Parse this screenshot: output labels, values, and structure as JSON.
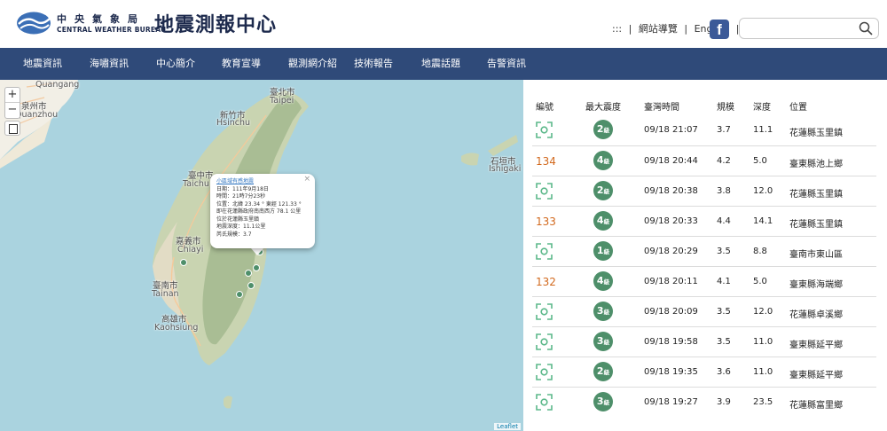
{
  "header": {
    "org_name_zh": "中央氣象局",
    "org_name_en": "CENTRAL WEATHER BUREAU",
    "site_title": "地震測報中心",
    "top_links": [
      ":::",
      "網站導覽",
      "English"
    ],
    "separator": "|",
    "facebook_glyph": "f",
    "search_placeholder": ""
  },
  "nav": [
    "地震資訊",
    "海嘯資訊",
    "中心簡介",
    "教育宣導",
    "觀測網介紹",
    "技術報告",
    "地震話題",
    "告警資訊"
  ],
  "map": {
    "labels": {
      "quangang": "Quangang",
      "quanzhou_zh": "泉州市",
      "quanzhou": "Quanzhou",
      "taipei_zh": "臺北市",
      "taipei": "Taipei",
      "hsinchu_zh": "新竹市",
      "hsinchu": "Hsinchu",
      "taichung_zh": "臺中市",
      "taichung": "Taichu",
      "chiayi_zh": "嘉義市",
      "chiayi": "Chiayi",
      "tainan_zh": "臺南市",
      "tainan": "Tainan",
      "kaohsiung_zh": "高雄市",
      "kaohsiung": "Kaohsiung",
      "ishigaki_zh": "石垣市",
      "ishigaki": "Ishigaki"
    },
    "zoom_in": "+",
    "zoom_out": "−",
    "attribution": "Leaflet",
    "popup": {
      "title": "小區域有感地震",
      "lines": [
        "日期：111年9月18日",
        "時間：21時7分23秒",
        "位置：北緯 23.34 ° 東經 121.33 °",
        "即在花蓮縣政府南南西方 78.1 公里",
        "位於花蓮縣玉里鎮",
        "地震深度：11.1公里",
        "芮氏規模：3.7"
      ],
      "close": "×"
    }
  },
  "table": {
    "headers": [
      "編號",
      "最大震度",
      "臺灣時間",
      "規模",
      "深度",
      "位置"
    ],
    "intensity_suffix": "級",
    "rows": [
      {
        "id": "",
        "intensity": "2",
        "time": "09/18 21:07",
        "magnitude": "3.7",
        "depth": "11.1",
        "location": "花蓮縣玉里鎮"
      },
      {
        "id": "134",
        "intensity": "4",
        "time": "09/18 20:44",
        "magnitude": "4.2",
        "depth": "5.0",
        "location": "臺東縣池上鄉"
      },
      {
        "id": "",
        "intensity": "2",
        "time": "09/18 20:38",
        "magnitude": "3.8",
        "depth": "12.0",
        "location": "花蓮縣玉里鎮"
      },
      {
        "id": "133",
        "intensity": "4",
        "time": "09/18 20:33",
        "magnitude": "4.4",
        "depth": "14.1",
        "location": "花蓮縣玉里鎮"
      },
      {
        "id": "",
        "intensity": "1",
        "time": "09/18 20:29",
        "magnitude": "3.5",
        "depth": "8.8",
        "location": "臺南市東山區"
      },
      {
        "id": "132",
        "intensity": "4",
        "time": "09/18 20:11",
        "magnitude": "4.1",
        "depth": "5.0",
        "location": "臺東縣海端鄉"
      },
      {
        "id": "",
        "intensity": "3",
        "time": "09/18 20:09",
        "magnitude": "3.5",
        "depth": "12.0",
        "location": "花蓮縣卓溪鄉"
      },
      {
        "id": "",
        "intensity": "3",
        "time": "09/18 19:58",
        "magnitude": "3.5",
        "depth": "11.0",
        "location": "臺東縣延平鄉"
      },
      {
        "id": "",
        "intensity": "2",
        "time": "09/18 19:35",
        "magnitude": "3.6",
        "depth": "11.0",
        "location": "臺東縣延平鄉"
      },
      {
        "id": "",
        "intensity": "3",
        "time": "09/18 19:27",
        "magnitude": "3.9",
        "depth": "23.5",
        "location": "花蓮縣富里鄉"
      }
    ]
  },
  "colors": {
    "nav_bg": "#2f4a79",
    "brand": "#1d2a4d",
    "intensity_badge": "#4e8f6a",
    "event_number": "#d2691e",
    "scan_icon": "#5cb88a"
  }
}
